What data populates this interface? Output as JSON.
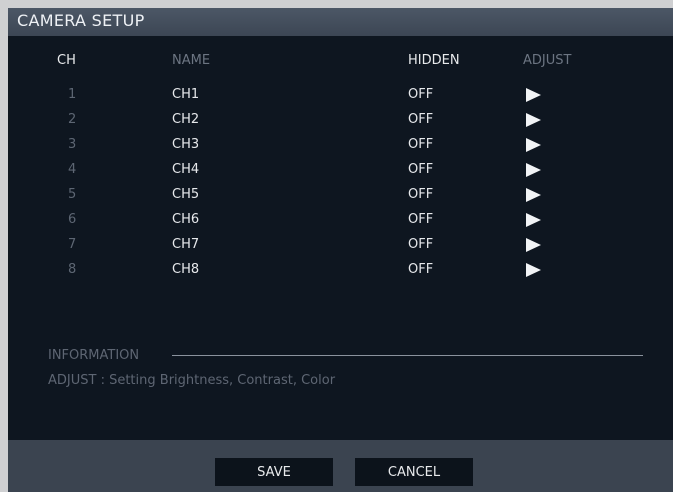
{
  "window": {
    "title": "CAMERA SETUP"
  },
  "columns": {
    "ch": "CH",
    "name": "NAME",
    "hidden": "HIDDEN",
    "adjust": "ADJUST"
  },
  "rows": [
    {
      "num": "1",
      "name": "CH1",
      "hidden": "OFF"
    },
    {
      "num": "2",
      "name": "CH2",
      "hidden": "OFF"
    },
    {
      "num": "3",
      "name": "CH3",
      "hidden": "OFF"
    },
    {
      "num": "4",
      "name": "CH4",
      "hidden": "OFF"
    },
    {
      "num": "5",
      "name": "CH5",
      "hidden": "OFF"
    },
    {
      "num": "6",
      "name": "CH6",
      "hidden": "OFF"
    },
    {
      "num": "7",
      "name": "CH7",
      "hidden": "OFF"
    },
    {
      "num": "8",
      "name": "CH8",
      "hidden": "OFF"
    }
  ],
  "adjust_icon": "play-arrow-icon",
  "information": {
    "label": "INFORMATION",
    "text": "ADJUST : Setting Brightness, Contrast, Color"
  },
  "buttons": {
    "save": "SAVE",
    "cancel": "CANCEL"
  }
}
